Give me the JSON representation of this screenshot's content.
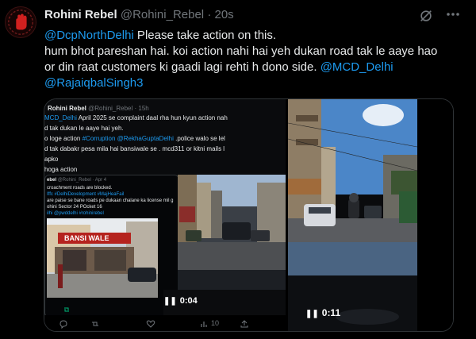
{
  "author": {
    "name": "Rohini Rebel",
    "handle": "@Rohini_Rebel",
    "separator": "·",
    "time": "20s"
  },
  "tweet": {
    "mention1": "@DcpNorthDelhi",
    "line1_rest": " Please take action on this.",
    "line2": "hum bhot pareshan hai. koi action nahi hai yeh dukan road tak le aaye hao",
    "line3": "or din raat customers ki gaadi lagi rehti h dono side. ",
    "mention2": "@MCD_Delhi",
    "mention3": "@RajaiqbalSingh3"
  },
  "video1": {
    "duration": "0:04",
    "quoted": {
      "author": "Rohini Rebel",
      "handle": "@Rohini_Rebel",
      "time": "· 15h",
      "l1a": "MCD_Delhi",
      "l1b": " April 2025 se complaint daal rha hun kyun action nah",
      "l2": "d tak dukan le aaye hai yeh.",
      "l3a": "o loge action ",
      "l3b": "#Corruption @RekhaGuptaDelhi",
      "l3c": " .police walo se lel",
      "l4": "d tak dabakr pesa mila hai bansiwale se . mcd311 or kitni mails l",
      "l5": "apko",
      "l6": " hoga action",
      "inner_author": "ebel",
      "inner_handle": "@Rohini_Rebel · Apr 4",
      "inner_l1": "croachment roads are blocked.",
      "inner_l2": "Iffc #DelhiDevelopment #MajHeaFail",
      "inner_l3": "are paise se bane roads pe dukaan chalane ka license mil g",
      "inner_l4": "ohini Sector 24 POcket 16",
      "inner_l5": "ilhi @pwddelhi #rohinirebel",
      "sign": "BANSI WALE",
      "metrics": {
        "views": "10"
      }
    }
  },
  "video2": {
    "duration": "0:11"
  },
  "colors": {
    "background": "#000000",
    "text": "#e7e9ea",
    "link": "#1d9bf0",
    "muted": "#71767b",
    "border": "#2f3336"
  },
  "icons": [
    "grok-icon",
    "more-icon",
    "pause-icon",
    "play-icon",
    "reply-icon",
    "repost-icon",
    "like-icon",
    "views-icon"
  ]
}
